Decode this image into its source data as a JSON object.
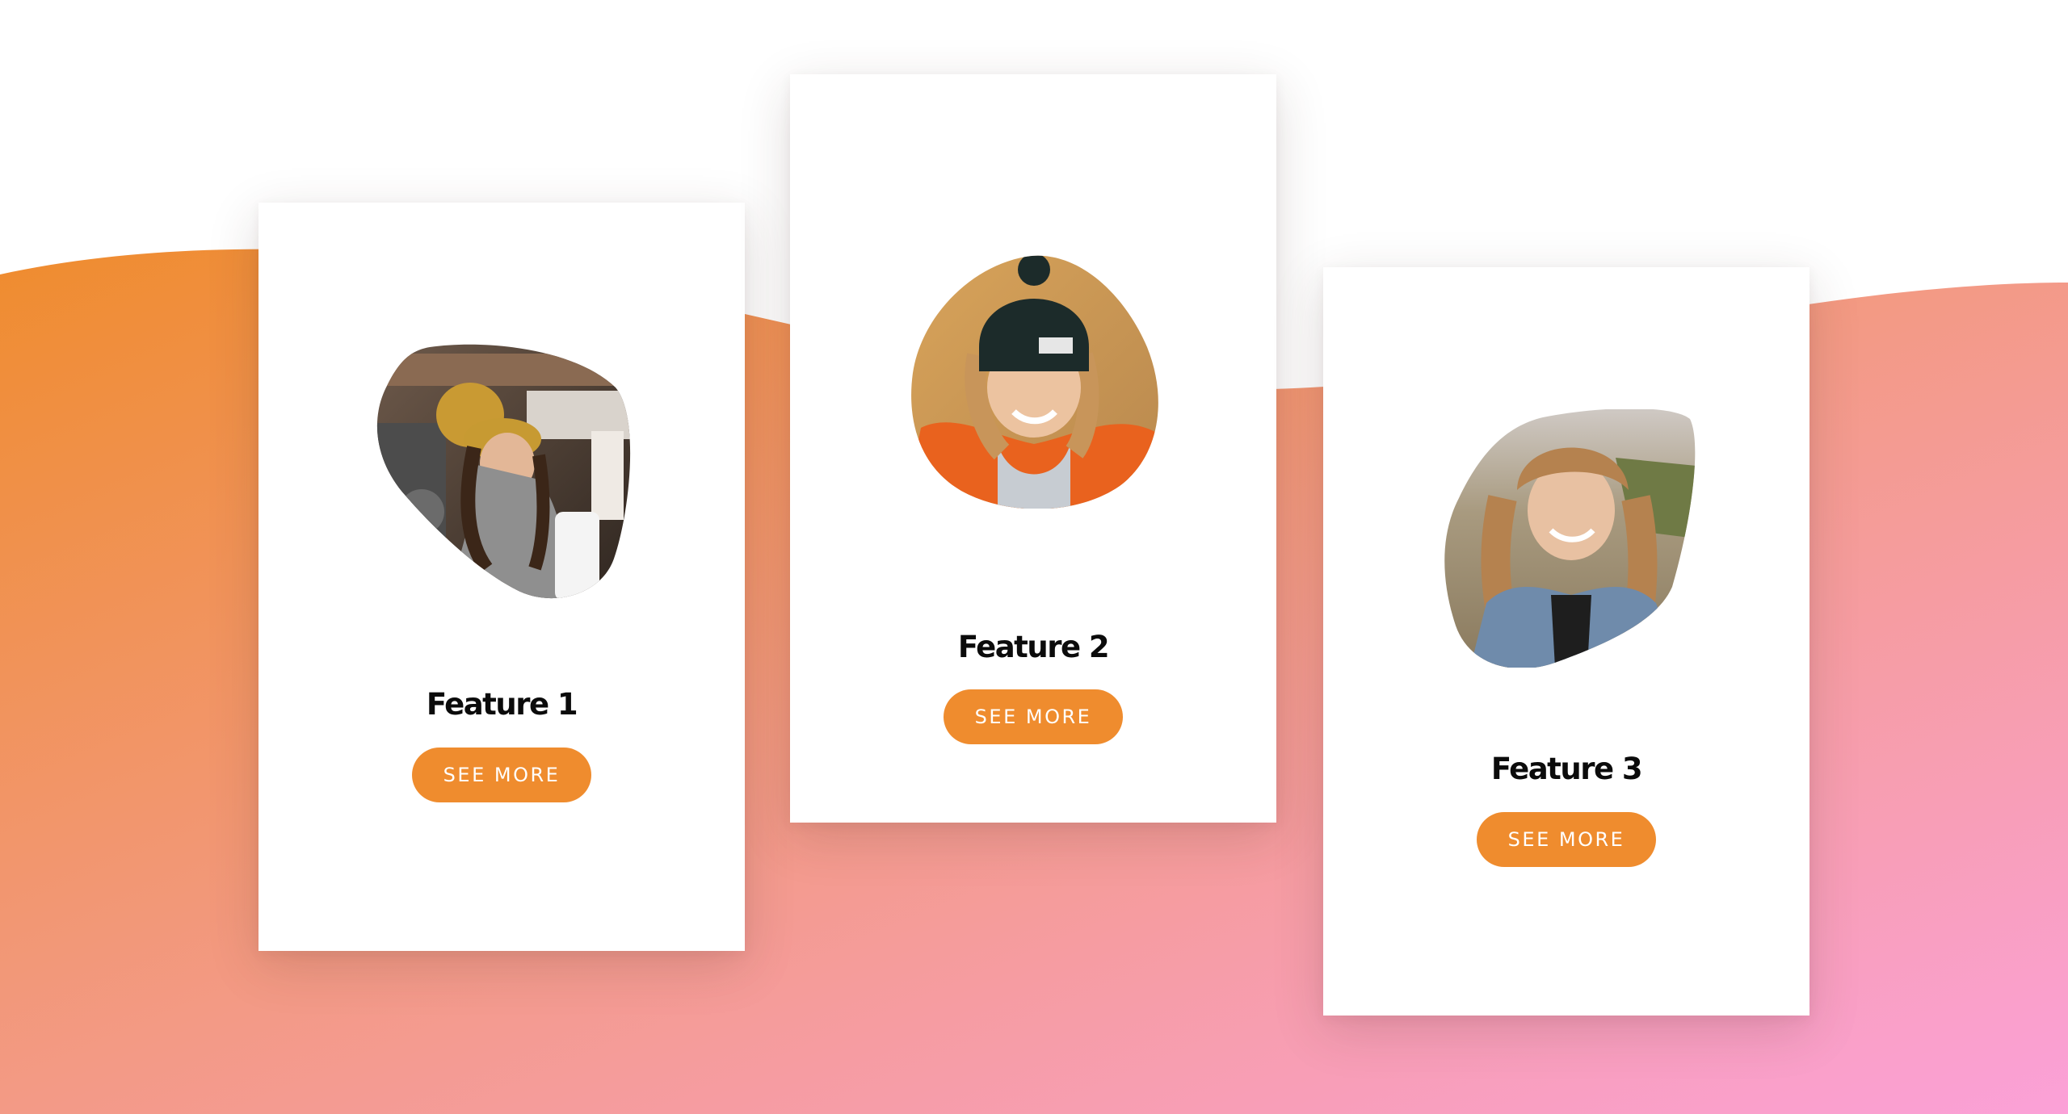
{
  "background": {
    "gradient_start": "#ef8c2e",
    "gradient_mid": "#f39a86",
    "gradient_end": "#fba1d8",
    "top_color": "#ffffff"
  },
  "accent_color": "#ef8c2e",
  "features": [
    {
      "title": "Feature 1",
      "button_label": "SEE MORE",
      "photo": "barista-woman-yellow-beanie-photo"
    },
    {
      "title": "Feature 2",
      "button_label": "SEE MORE",
      "photo": "woman-black-beanie-orange-jacket-photo"
    },
    {
      "title": "Feature 3",
      "button_label": "SEE MORE",
      "photo": "woman-denim-jacket-field-photo"
    }
  ]
}
